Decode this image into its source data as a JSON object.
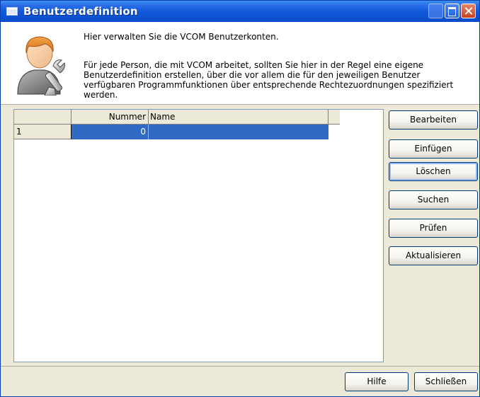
{
  "window": {
    "title": "Benutzerdefinition"
  },
  "header": {
    "intro": "Hier verwalten Sie die VCOM Benutzerkonten.",
    "description": "Für jede Person, die mit VCOM arbeitet, sollten Sie hier in der Regel eine eigene Benutzerdefinition erstellen, über die vor allem die für den jeweiligen Benutzer verfügbaren Programmfunktionen über entsprechende Rechtezuordnungen spezifiziert werden."
  },
  "table": {
    "columns": [
      "",
      "Nummer",
      "Name"
    ],
    "rows": [
      {
        "index": "1",
        "nummer": "0",
        "name": ""
      }
    ]
  },
  "actions": {
    "bearbeiten": "Bearbeiten",
    "einfuegen": "Einfügen",
    "loeschen": "Löschen",
    "suchen": "Suchen",
    "pruefen": "Prüfen",
    "aktualisieren": "Aktualisieren"
  },
  "footer": {
    "hilfe": "Hilfe",
    "schliessen": "Schließen"
  },
  "colors": {
    "selection": "#316ac5",
    "titlebar": "#0a4cc8"
  }
}
